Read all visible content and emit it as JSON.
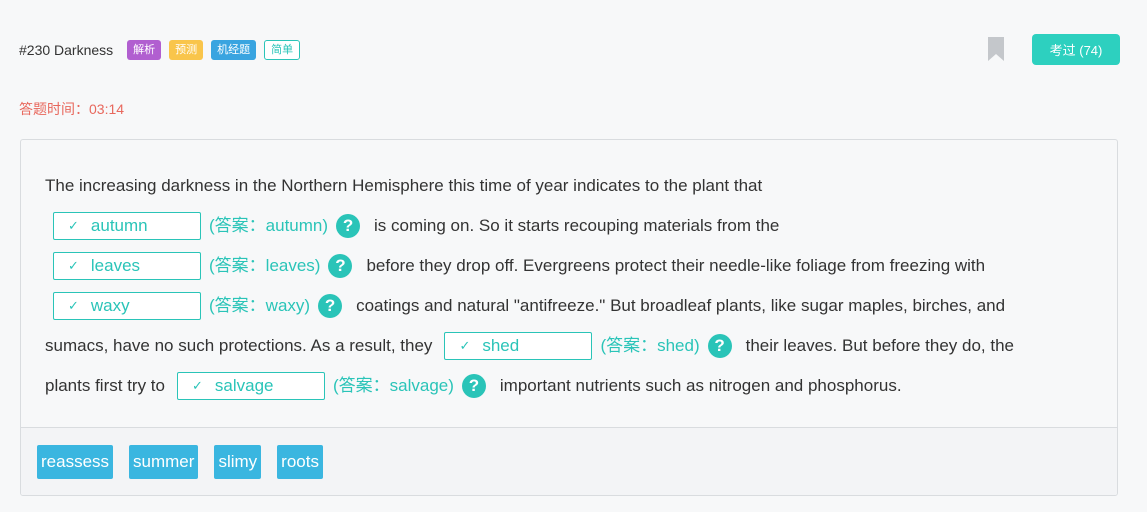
{
  "header": {
    "title": "#230 Darkness",
    "tags": [
      "解析",
      "预测",
      "机经题",
      "简单"
    ],
    "exam_button": "考过 (74)"
  },
  "timer": "答题时间：03:14",
  "passage": {
    "l1_text": "The increasing darkness in the Northern Hemisphere this time of year indicates to the plant that",
    "l2_after": "is coming on. So it starts recouping materials from the",
    "l3_after": "before they drop off. Evergreens protect their needle-like foliage from freezing with",
    "l4_after": "coatings and natural \"antifreeze.\" But broadleaf plants, like sugar maples, birches, and",
    "l5_before": "sumacs, have no such protections. As a result, they",
    "l5_after": "their leaves. But before they do, the",
    "l6_before": "plants first try to",
    "l6_after": "important nutrients such as nitrogen and phosphorus.",
    "blanks": [
      {
        "value": "autumn",
        "answer": "(答案：autumn)"
      },
      {
        "value": "leaves",
        "answer": "(答案：leaves)"
      },
      {
        "value": "waxy",
        "answer": "(答案：waxy)"
      },
      {
        "value": "shed",
        "answer": "(答案：shed)"
      },
      {
        "value": "salvage",
        "answer": "(答案：salvage)"
      }
    ],
    "check_glyph": "✓",
    "help_glyph": "?"
  },
  "word_bank": [
    "reassess",
    "summer",
    "slimy",
    "roots"
  ],
  "colors": {
    "accent": "#2ac4b8",
    "button": "#2dd0bf",
    "timer": "#e8685d",
    "word_chip": "#3ab6e0"
  }
}
